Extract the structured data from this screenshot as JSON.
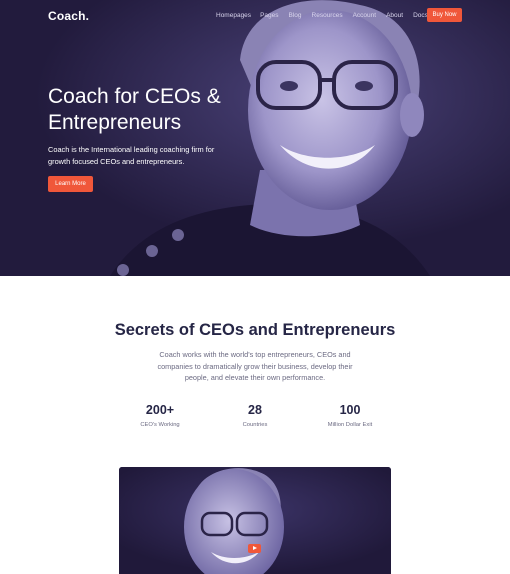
{
  "brand": {
    "logo": "Coach."
  },
  "nav": {
    "links": [
      "Homepages",
      "Pages",
      "Blog",
      "Resources",
      "Account",
      "About",
      "Docs"
    ],
    "cta": "Buy Now"
  },
  "hero": {
    "title": "Coach for CEOs & Entrepreneurs",
    "subtitle": "Coach is the International leading coaching firm for growth focused CEOs and entrepreneurs.",
    "button": "Learn More"
  },
  "intro": {
    "title": "Secrets of CEOs and Entrepreneurs",
    "text": "Coach works with the world's top entrepreneurs, CEOs and companies to dramatically grow their business, develop their people, and elevate their own performance."
  },
  "stats": [
    {
      "value": "200+",
      "label": "CEO's Working"
    },
    {
      "value": "28",
      "label": "Countries"
    },
    {
      "value": "100",
      "label": "Million Dollar Exit"
    }
  ],
  "video": {
    "play_icon": "play-icon"
  },
  "colors": {
    "accent": "#f0573a",
    "hero_bg": "#221b3d",
    "heading": "#262646"
  }
}
